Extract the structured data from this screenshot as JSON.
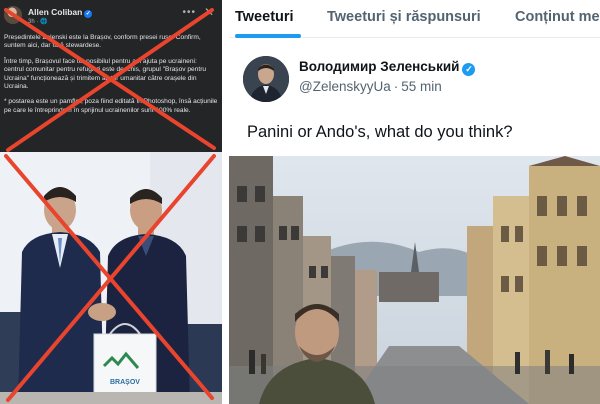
{
  "facebook_post": {
    "author": "Allen Coliban",
    "meta": "3h · 🌐",
    "menu_icon": "more-icon",
    "close_icon": "close-icon",
    "paragraphs": [
      "Președintele Zelenski este la Brașov, conform presei ruse. Confirm, suntem aici, dar fără stewardese.",
      "Între timp, Brașovul face tot posibilul pentru a îi ajuta pe ucraineni: centrul comunitar pentru refugiați este deschis, grupul \"Brașov pentru Ucraina\" funcționează și trimitem ajutor umanitar către orașele din Ucraina.",
      "* postarea este un pamflet, poza fiind editată în Photoshop, însă acțiunile pe care le întreprindem în sprijinul ucrainenilor sunt 100% reale."
    ],
    "cross_color": "#e8442e"
  },
  "photo_left": {
    "bag_text": "BRAȘOV",
    "cross_color": "#e8442e"
  },
  "twitter": {
    "tabs": [
      {
        "label": "Tweeturi",
        "active": true
      },
      {
        "label": "Tweeturi și răspunsuri",
        "active": false
      },
      {
        "label": "Conținut media",
        "active": false
      }
    ],
    "accent_color": "#1d9bf0",
    "tweet": {
      "display_name": "Володимир Зеленський",
      "verified": true,
      "handle": "@ZelenskyyUa",
      "separator": "·",
      "time": "55 min",
      "text": "Panini or Ando's, what do you think?"
    }
  }
}
